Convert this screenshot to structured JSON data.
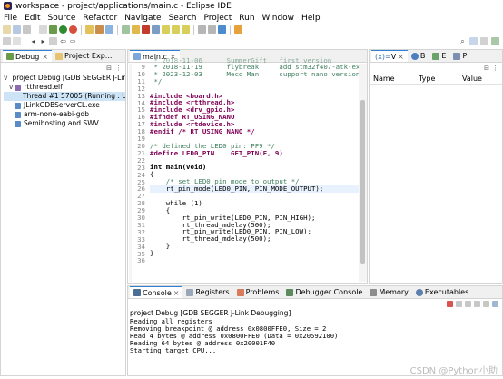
{
  "window": {
    "title": "workspace - project/applications/main.c - Eclipse IDE"
  },
  "menu": [
    "File",
    "Edit",
    "Source",
    "Refactor",
    "Navigate",
    "Search",
    "Project",
    "Run",
    "Window",
    "Help"
  ],
  "left_panel": {
    "tabs": [
      "Debug",
      "Project Exp..."
    ],
    "tree": [
      {
        "label": "project Debug [GDB SEGGER J-Link",
        "level": 0,
        "icon": "debug-config-icon"
      },
      {
        "label": "rtthread.elf",
        "level": 1,
        "icon": "elf-icon"
      },
      {
        "label": "Thread #1 57005 (Running : User",
        "level": 2,
        "icon": "thread-icon",
        "selected": true
      },
      {
        "label": "JLinkGDBServerCL.exe",
        "level": 1,
        "icon": "process-icon"
      },
      {
        "label": "arm-none-eabi-gdb",
        "level": 1,
        "icon": "process-icon"
      },
      {
        "label": "Semihosting and SWV",
        "level": 1,
        "icon": "process-icon"
      }
    ]
  },
  "editor": {
    "tab": "main.c",
    "lines": [
      {
        "n": "9",
        "text": " * 2018-11-19      flybreak     add stm32f407-atk-explorer bs"
      },
      {
        "n": "10",
        "text": " * 2023-12-03      Meco Man     support nano version"
      },
      {
        "n": "11",
        "text": " */"
      },
      {
        "n": "12",
        "text": ""
      },
      {
        "n": "13",
        "text": "#include <board.h>"
      },
      {
        "n": "14",
        "text": "#include <rtthread.h>"
      },
      {
        "n": "15",
        "text": "#include <drv_gpio.h>"
      },
      {
        "n": "16",
        "text": "#ifndef RT_USING_NANO"
      },
      {
        "n": "17",
        "text": "#include <rtdevice.h>"
      },
      {
        "n": "18",
        "text": "#endif /* RT_USING_NANO */"
      },
      {
        "n": "19",
        "text": ""
      },
      {
        "n": "20",
        "text": "/* defined the LED0 pin: PF9 */"
      },
      {
        "n": "21",
        "text": "#define LED0_PIN    GET_PIN(F, 9)"
      },
      {
        "n": "22",
        "text": ""
      },
      {
        "n": "23",
        "text": "int main(void)"
      },
      {
        "n": "24",
        "text": "{"
      },
      {
        "n": "25",
        "text": "    /* set LED0 pin mode to output */"
      },
      {
        "n": "26",
        "text": "    rt_pin_mode(LED0_PIN, PIN_MODE_OUTPUT);"
      },
      {
        "n": "27",
        "text": ""
      },
      {
        "n": "28",
        "text": "    while (1)"
      },
      {
        "n": "29",
        "text": "    {"
      },
      {
        "n": "30",
        "text": "        rt_pin_write(LED0_PIN, PIN_HIGH);"
      },
      {
        "n": "31",
        "text": "        rt_thread_mdelay(500);"
      },
      {
        "n": "32",
        "text": "        rt_pin_write(LED0_PIN, PIN_LOW);"
      },
      {
        "n": "33",
        "text": "        rt_thread_mdelay(500);"
      },
      {
        "n": "34",
        "text": "    }"
      },
      {
        "n": "35",
        "text": "}"
      },
      {
        "n": "36",
        "text": ""
      }
    ],
    "top_partial": " * 2018-11-06      SummerGift   first version"
  },
  "right_panel": {
    "tabs": [
      "V",
      "B",
      "E",
      "P"
    ],
    "columns": [
      "Name",
      "Type",
      "Value"
    ]
  },
  "bottom_panel": {
    "tabs": [
      "Console",
      "Registers",
      "Problems",
      "Debugger Console",
      "Memory",
      "Executables"
    ],
    "header": "project Debug [GDB SEGGER J-Link Debugging]",
    "lines": [
      "Reading all registers",
      "Removing breakpoint @ address 0x0800FFE0, Size = 2",
      "Read 4 bytes @ address 0x0800FFE0 (Data = 0x20592100)",
      "Reading 64 bytes @ address 0x20001F40",
      "Starting target CPU..."
    ]
  },
  "watermark": "CSDN @Python小助"
}
